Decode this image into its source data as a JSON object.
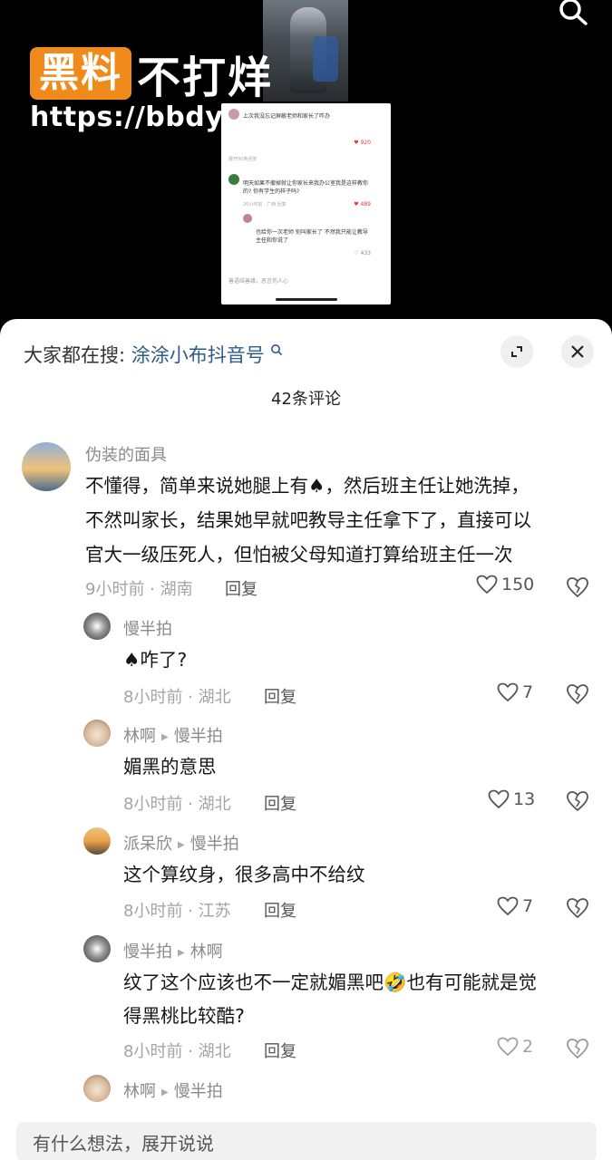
{
  "watermark": {
    "brand_box": "黑料",
    "brand_text": "不打烊",
    "url": "https://bbdy15.com"
  },
  "embedded_screenshot": {
    "line1": "明天如果不撤掉就让你家长来我办公室我是这样教你的? 你有学生的样子吗?",
    "line1_likes": "489",
    "line1_meta": "20小时前 · 广西  回复",
    "line2": "也给你一次老师 别叫家长了 不然我只能让教导主任和你说了",
    "line2_likes": "433",
    "top_likes": "920",
    "top_text": "上次我没忘记屏蔽老师和家长了咋办",
    "expand": "展开90条回复",
    "input_placeholder": "善语结善缘，恶言伤人心"
  },
  "sheet": {
    "hot_search_prefix": "大家都在搜: ",
    "hot_search_keyword": "涂涂小布抖音号",
    "comment_count": "42条评论",
    "input_placeholder": "有什么想法，展开说说"
  },
  "comments": [
    {
      "name": "伪装的面具",
      "body1": "不懂得，简单来说她腿上有♠，然后班主任让她洗掉，",
      "body2": "不然叫家长，结果她早就吧教导主任拿下了，直接可以",
      "body3": "官大一级压死人，但怕被父母知道打算给班主任一次",
      "meta": "9小时前 · 湖南",
      "reply": "回复",
      "likes": "150"
    },
    {
      "name": "慢半拍",
      "body1": "♠咋了?",
      "meta": "8小时前 · 湖北",
      "reply": "回复",
      "likes": "7"
    },
    {
      "name": "林啊",
      "reply_to": "慢半拍",
      "body1": "媚黑的意思",
      "meta": "8小时前 · 湖北",
      "reply": "回复",
      "likes": "13"
    },
    {
      "name": "派呆欣",
      "reply_to": "慢半拍",
      "body1": "这个算纹身，很多高中不给纹",
      "meta": "8小时前 · 江苏",
      "reply": "回复",
      "likes": "7"
    },
    {
      "name": "慢半拍",
      "reply_to": "林啊",
      "body1": "纹了这个应该也不一定就媚黑吧🤣也有可能就是觉",
      "body2": "得黑桃比较酷?",
      "meta": "8小时前 · 湖北",
      "reply": "回复",
      "likes": "2"
    },
    {
      "name": "林啊",
      "reply_to": "慢半拍"
    }
  ],
  "colors": {
    "brand_orange": "#f08a1a",
    "keyword_blue": "#2f5a8c",
    "sheet_bg": "#ffffff"
  },
  "icons": [
    "search-icon",
    "expand-icon",
    "close-icon",
    "heart-icon",
    "broken-heart-icon"
  ]
}
